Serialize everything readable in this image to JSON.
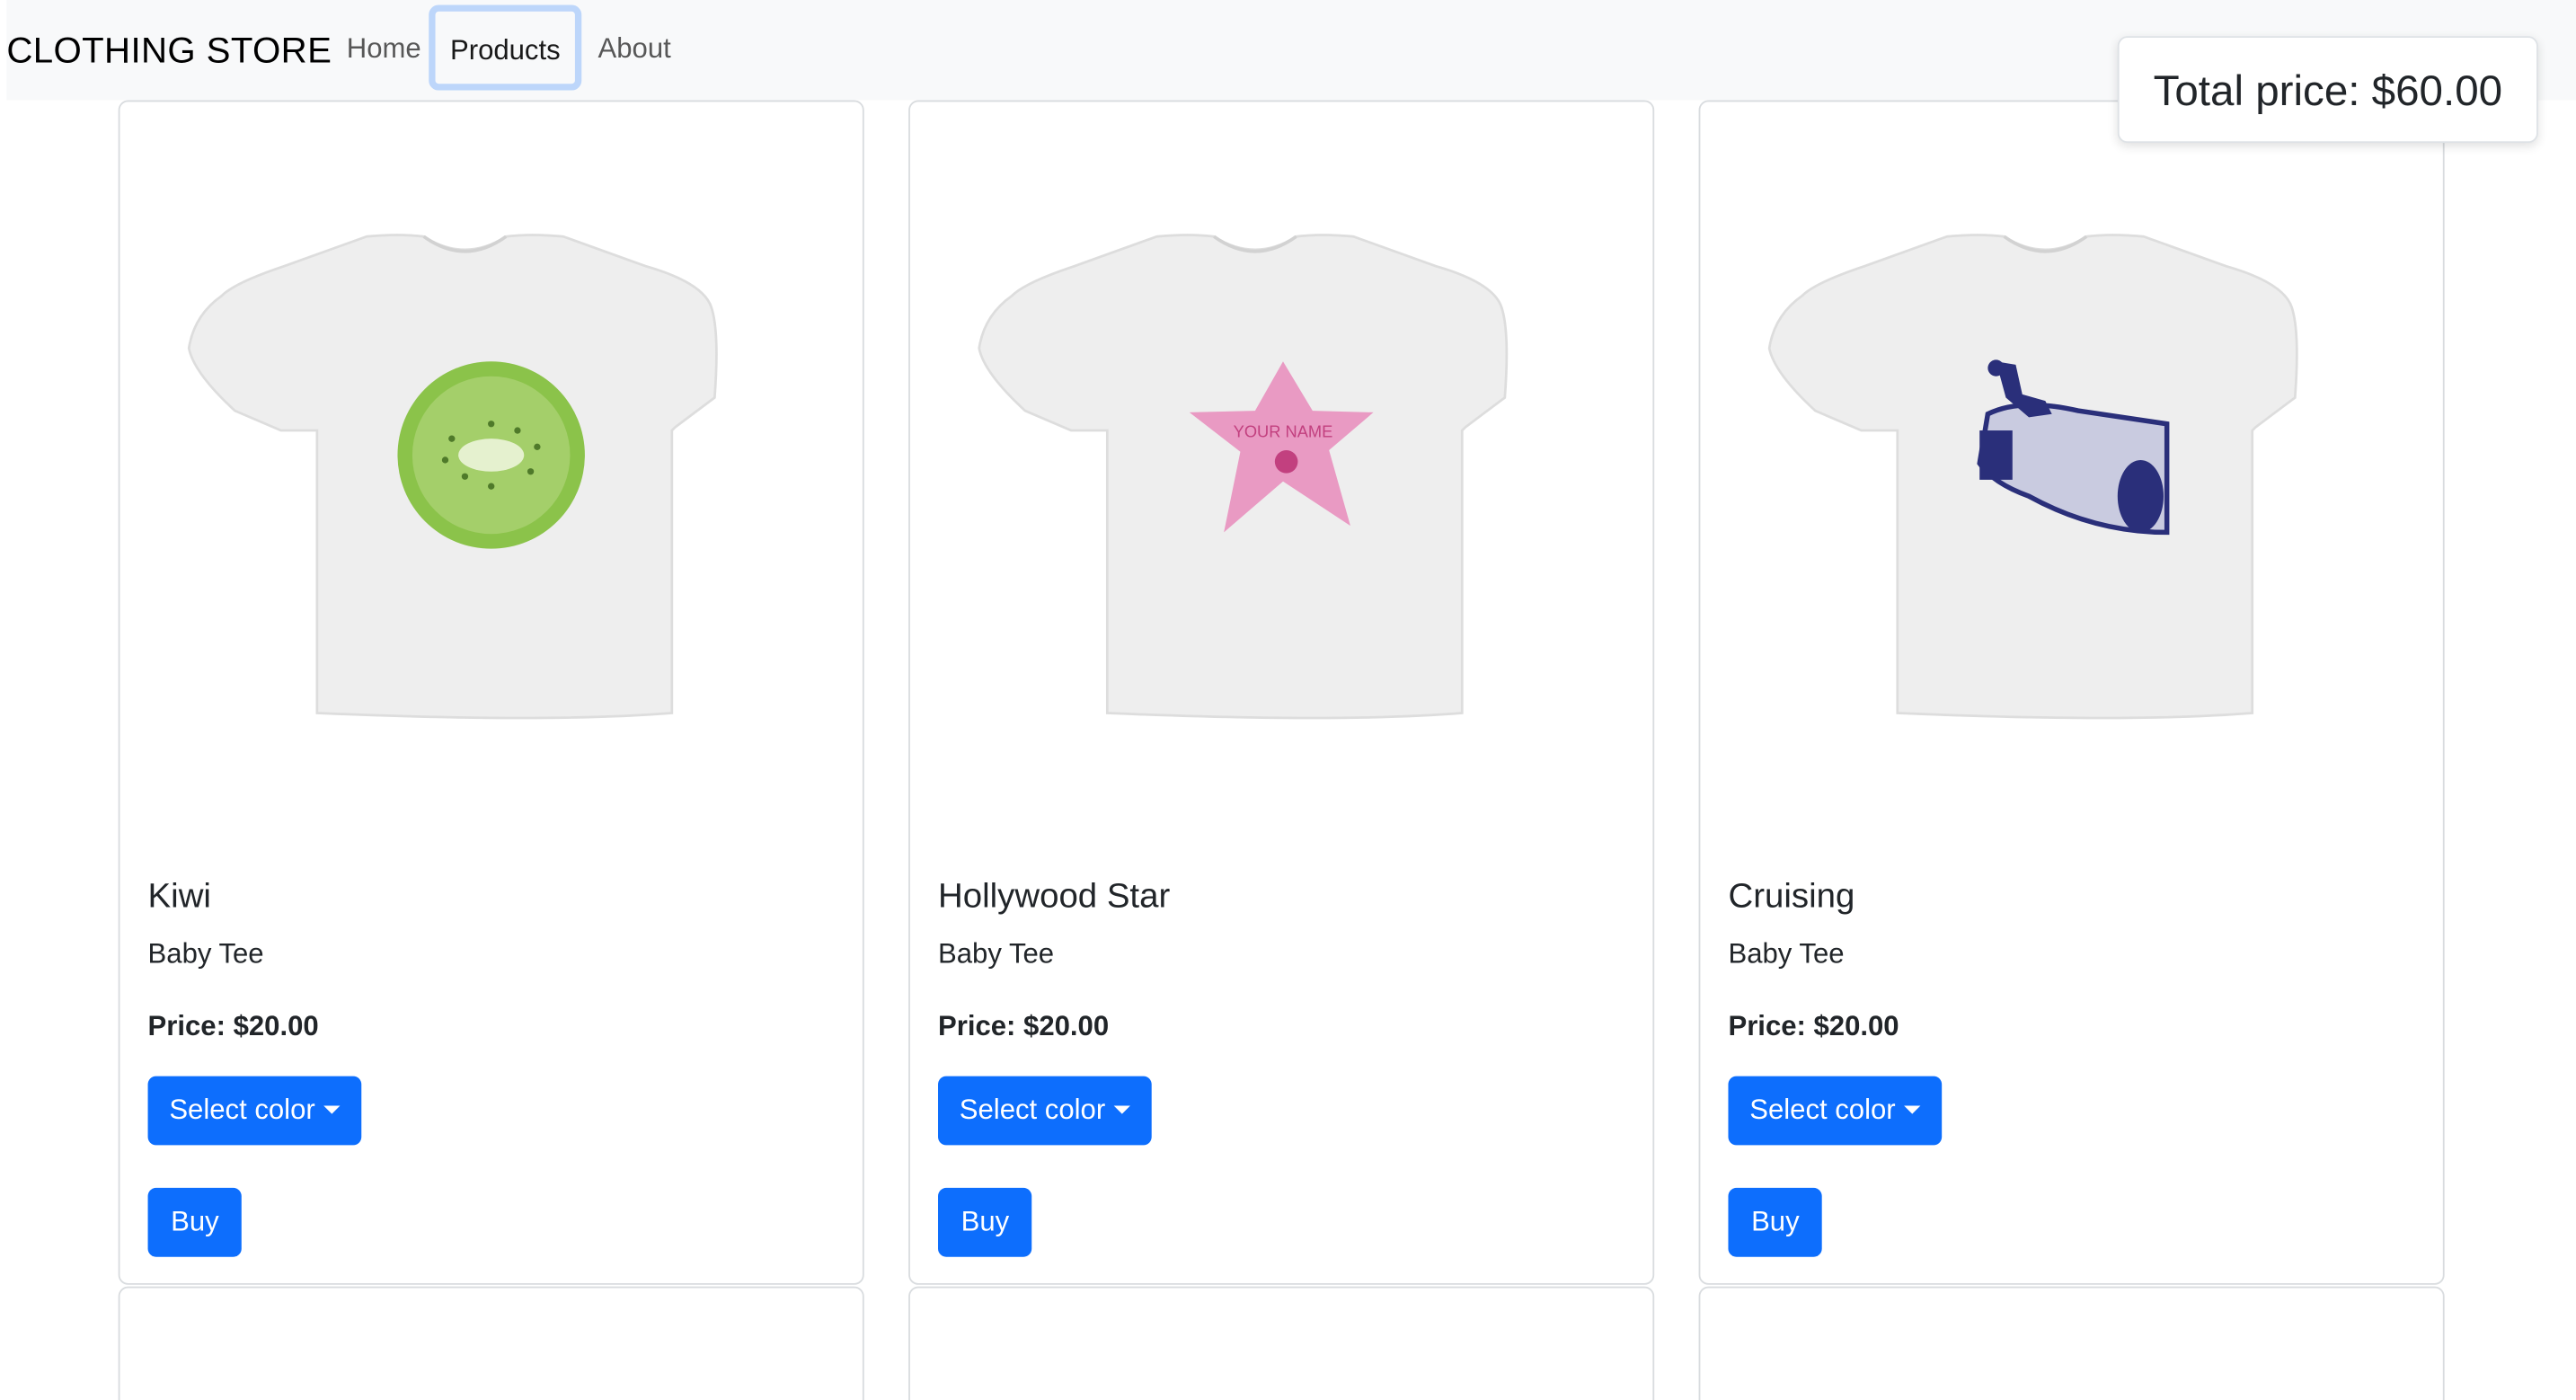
{
  "nav": {
    "brand": "CLOTHING STORE",
    "links": [
      {
        "label": "Home"
      },
      {
        "label": "Products",
        "active": true
      },
      {
        "label": "About"
      }
    ]
  },
  "total": {
    "text": "Total price: $60.00"
  },
  "products": [
    {
      "name": "Kiwi",
      "type": "Baby Tee",
      "price": "Price: $20.00",
      "select_label": "Select color",
      "buy_label": "Buy",
      "print": "kiwi slice",
      "print_color": "#7cb342"
    },
    {
      "name": "Hollywood Star",
      "type": "Baby Tee",
      "price": "Price: $20.00",
      "select_label": "Select color",
      "buy_label": "Buy",
      "print": "pink star",
      "print_text": "YOUR NAME",
      "print_color": "#e88ab8"
    },
    {
      "name": "Cruising",
      "type": "Baby Tee",
      "price": "Price: $20.00",
      "select_label": "Select color",
      "buy_label": "Buy",
      "print": "vintage car with figure",
      "print_color": "#2a2f7a"
    }
  ],
  "colors": {
    "primary": "#0d6efd",
    "navbar_bg": "#f8f9fa"
  }
}
